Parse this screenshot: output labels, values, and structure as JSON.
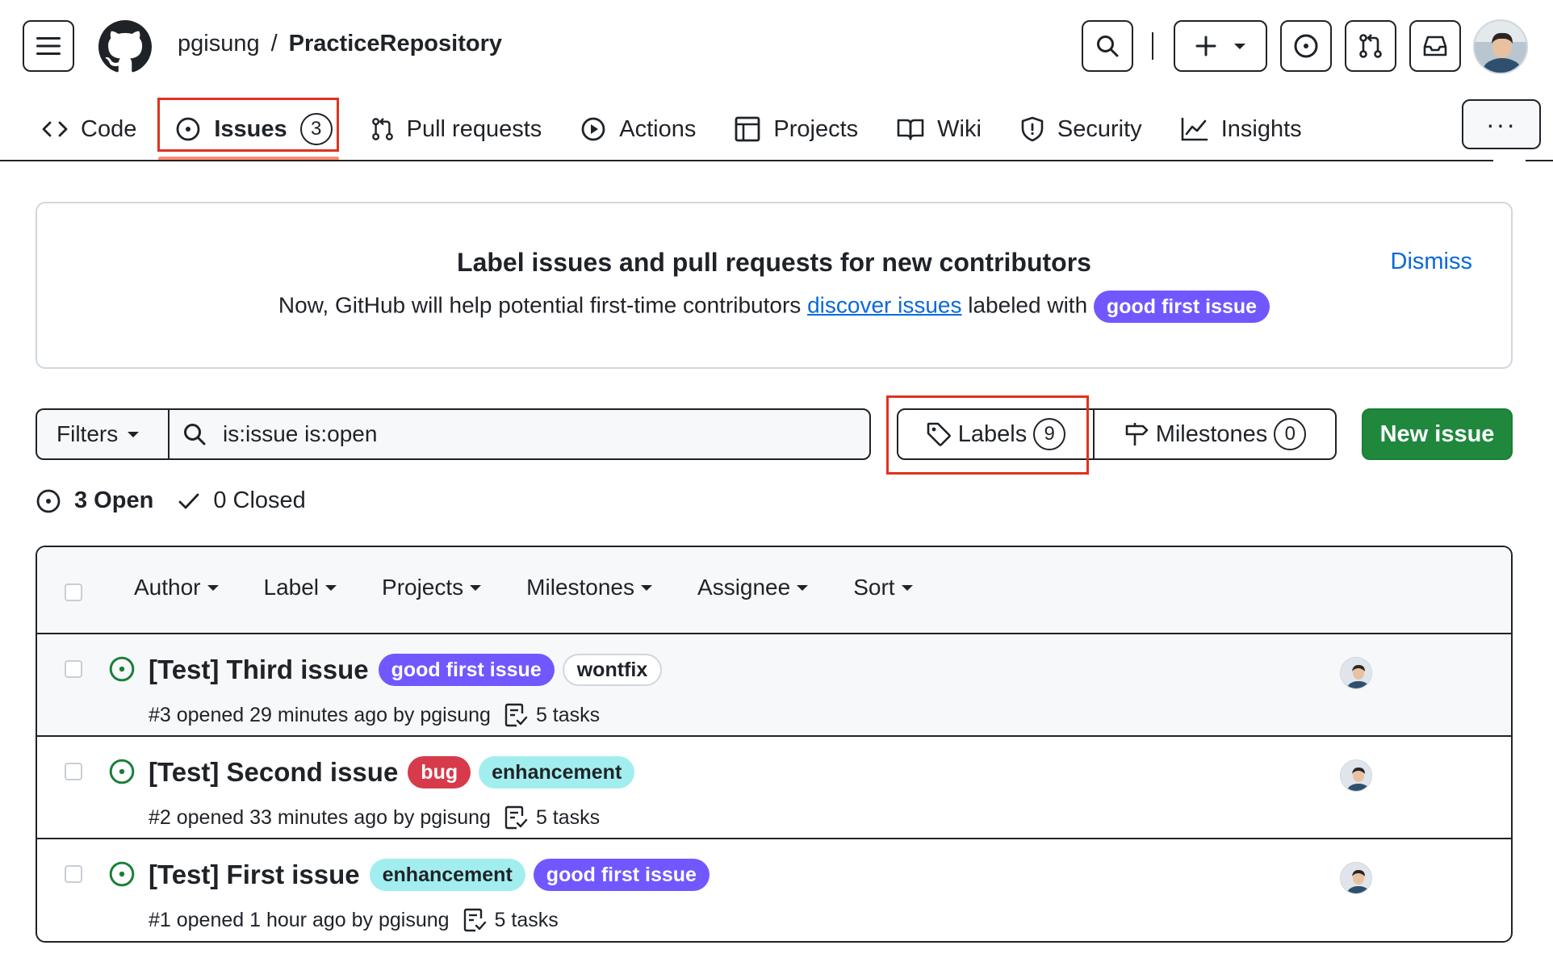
{
  "header": {
    "owner": "pgisung",
    "separator": "/",
    "repo": "PracticeRepository"
  },
  "tabs": [
    {
      "label": "Code"
    },
    {
      "label": "Issues",
      "count": "3"
    },
    {
      "label": "Pull requests"
    },
    {
      "label": "Actions"
    },
    {
      "label": "Projects"
    },
    {
      "label": "Wiki"
    },
    {
      "label": "Security"
    },
    {
      "label": "Insights"
    }
  ],
  "more_label": "···",
  "banner": {
    "title": "Label issues and pull requests for new contributors",
    "text_before": "Now, GitHub will help potential first-time contributors ",
    "link": "discover issues",
    "text_after": " labeled with ",
    "label": "good first issue",
    "dismiss": "Dismiss"
  },
  "filterbar": {
    "filters_label": "Filters",
    "search_value": "is:issue is:open",
    "labels_label": "Labels",
    "labels_count": "9",
    "milestones_label": "Milestones",
    "milestones_count": "0",
    "new_issue": "New issue"
  },
  "states": {
    "open": "3 Open",
    "closed": "0 Closed"
  },
  "list_head": [
    "Author",
    "Label",
    "Projects",
    "Milestones",
    "Assignee",
    "Sort"
  ],
  "issues": [
    {
      "title": "[Test] Third issue",
      "labels": [
        {
          "name": "good first issue",
          "kind": "gfi"
        },
        {
          "name": "wontfix",
          "kind": "wont"
        }
      ],
      "meta": "#3 opened 29 minutes ago by pgisung",
      "tasks": "5 tasks"
    },
    {
      "title": "[Test] Second issue",
      "labels": [
        {
          "name": "bug",
          "kind": "bug"
        },
        {
          "name": "enhancement",
          "kind": "enh"
        }
      ],
      "meta": "#2 opened 33 minutes ago by pgisung",
      "tasks": "5 tasks"
    },
    {
      "title": "[Test] First issue",
      "labels": [
        {
          "name": "enhancement",
          "kind": "enh"
        },
        {
          "name": "good first issue",
          "kind": "gfi"
        }
      ],
      "meta": "#1 opened 1 hour ago by pgisung",
      "tasks": "5 tasks"
    }
  ],
  "colors": {
    "gfi": "#7057ff",
    "wontfix_bg": "#ffffff",
    "bug": "#d73a4a",
    "enhancement": "#a2eeef",
    "new_issue_bg": "#1f883d",
    "open_icon": "#1a7f37",
    "highlight_box": "#e0321e",
    "link": "#0969da"
  }
}
